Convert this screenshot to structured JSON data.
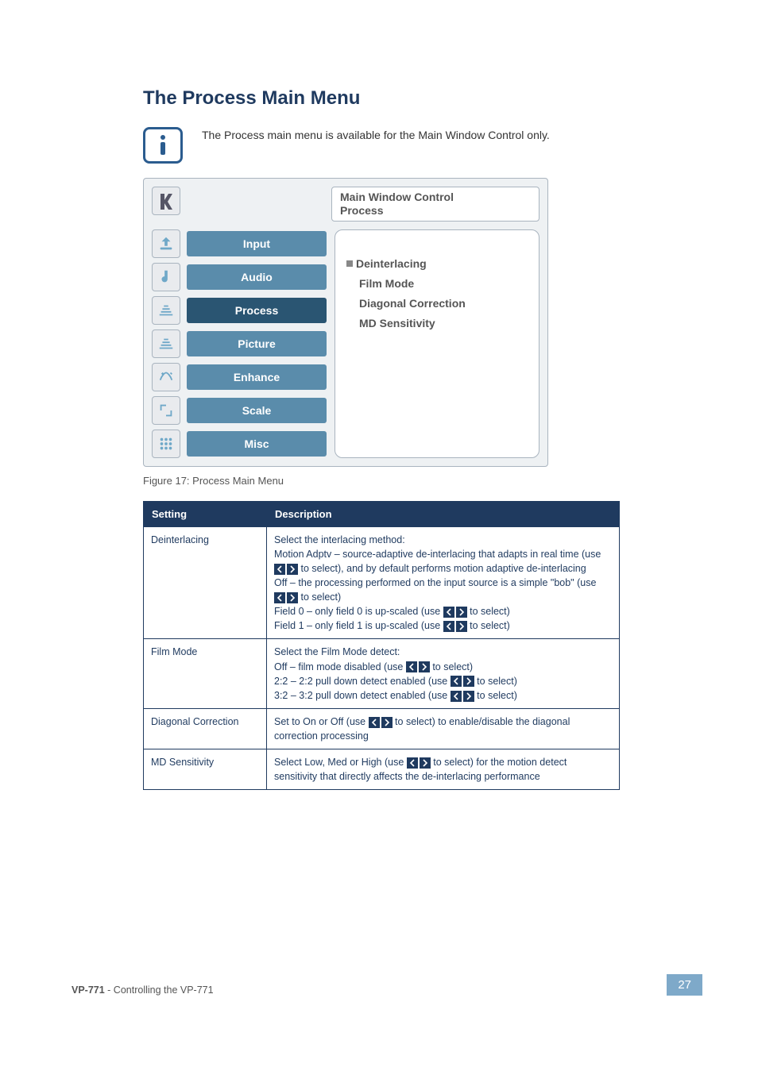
{
  "section_title": "The Process Main Menu",
  "info_note": "The Process main menu is available for the Main Window Control only.",
  "panel": {
    "header_line1": "Main Window Control",
    "header_line2": "Process",
    "menu": [
      {
        "label": "Input"
      },
      {
        "label": "Audio"
      },
      {
        "label": "Process",
        "active": true
      },
      {
        "label": "Picture"
      },
      {
        "label": "Enhance"
      },
      {
        "label": "Scale"
      },
      {
        "label": "Misc"
      }
    ],
    "options": [
      {
        "label": "Deinterlacing",
        "bullet": true
      },
      {
        "label": "Film Mode"
      },
      {
        "label": "Diagonal Correction"
      },
      {
        "label": "MD Sensitivity"
      }
    ]
  },
  "figure_caption": "Figure 17: Process Main Menu",
  "table": {
    "headers": [
      "Setting",
      "Description"
    ],
    "rows": [
      {
        "setting": "Deinterlacing",
        "desc_parts": [
          "Select the interlacing method:",
          {
            "label": "Motion Adptv",
            "before": " – source-adaptive de-interlacing that adapts in real time (use ",
            "arrows": true,
            "after": " to select), and by default performs motion adaptive de-interlacing"
          },
          {
            "label": "Off",
            "before": " – the processing performed on the input source is a simple \"bob\" (use ",
            "arrows": true,
            "after": " to select)"
          },
          {
            "label": "Field 0",
            "before": " – only field 0 is up-scaled (use ",
            "arrows": true,
            "after": " to select)"
          },
          {
            "label": "Field 1",
            "before": " – only field 1 is up-scaled (use ",
            "arrows": true,
            "after": " to select)"
          }
        ]
      },
      {
        "setting": "Film Mode",
        "desc_parts": [
          "Select the Film Mode detect:",
          {
            "label": "Off",
            "before": " – film mode disabled (use ",
            "arrows": true,
            "after": " to select)"
          },
          {
            "label": "2:2",
            "before": " – 2:2 pull down detect enabled (use ",
            "arrows": true,
            "after": " to select)"
          },
          {
            "label": "3:2",
            "before": " – 3:2 pull down detect enabled (use ",
            "arrows": true,
            "after": " to select)"
          }
        ]
      },
      {
        "setting": "Diagonal Correction",
        "desc_parts": [
          {
            "plain_before": "Set to On or Off (use ",
            "arrows": true,
            "plain_after": " to select) to enable/disable the diagonal correction processing"
          }
        ]
      },
      {
        "setting": "MD Sensitivity",
        "desc_parts": [
          {
            "plain_before": "Select Low, Med or High (use ",
            "arrows": true,
            "plain_after": " to select) for the motion detect sensitivity that directly affects the de-interlacing performance"
          }
        ]
      }
    ]
  },
  "footer": {
    "model": "VP-771",
    "text": " - Controlling the VP-771"
  },
  "page_number": "27",
  "icons": {
    "info": "info-icon",
    "logo": "kramer-logo-icon"
  }
}
